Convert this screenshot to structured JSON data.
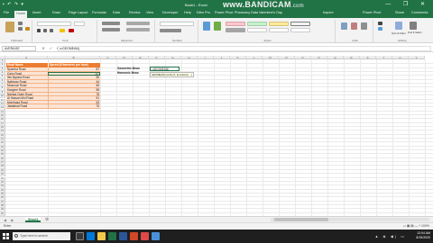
{
  "titlebar": {
    "quick_access": "▪ ↶ ↷ ▾",
    "document": "Book1 - Excel",
    "watermark": "www.BANDICAM",
    "watermark_suffix": ".com",
    "window_controls": "—  ❐  ✕"
  },
  "tabs": {
    "items": [
      "File",
      "Home",
      "Insert",
      "Draw",
      "Page Layout",
      "Formulas",
      "Data",
      "Review",
      "View",
      "Developer",
      "Help",
      "Nitro Pro",
      "Power Pivot",
      "Pharmacy Data",
      "Valentine's Day",
      "Inquire",
      "Power Pivot"
    ],
    "share": "Share",
    "comments": "Comments"
  },
  "ribbon": {
    "clipboard": "Clipboard",
    "font": "Font",
    "alignment": "Alignment",
    "number": "Number",
    "styles": "Styles",
    "cells": "Cells",
    "editing": "Editing",
    "conditional_formatting": "Conditional Formatting",
    "format_as_table": "Format as Table",
    "cell_styles": "Cell Styles",
    "sort_filter": "Sort & Filter",
    "find_select": "Find & Select"
  },
  "formula_bar": {
    "name_box": "AVERAGE",
    "fx": "✕ ✓ fx",
    "formula": "=GEOMEAN("
  },
  "columns": [
    "A",
    "B",
    "C",
    "D",
    "E",
    "F",
    "G",
    "H",
    "I",
    "J",
    "K",
    "L",
    "M",
    "N",
    "O",
    "P",
    "Q",
    "R",
    "S",
    "T",
    "U",
    "V"
  ],
  "rows": [
    "1",
    "2",
    "3",
    "4",
    "5",
    "6",
    "7",
    "8",
    "9",
    "10",
    "11",
    "12",
    "13",
    "14",
    "15",
    "16",
    "17",
    "18",
    "19",
    "20",
    "21",
    "22",
    "23",
    "24",
    "25",
    "26",
    "27",
    "28",
    "29",
    "30",
    "31",
    "32",
    "33",
    "34",
    "35",
    "36",
    "37",
    "38",
    "39",
    "40"
  ],
  "table": {
    "header_a": "Road Name",
    "header_b": "Speed (Kilometres per hour)",
    "names": [
      "Nyamira Road",
      "Cairo Road",
      "Ibis Bypass Road",
      "Nakhugo Road",
      "Mnamuzi Road",
      "Kangere Road",
      "Ndetea Outer Road",
      "Al Hassan Moi Road",
      "Mombasa Road",
      "Jalalabad Road"
    ],
    "speeds": [
      "87",
      "45",
      "56",
      "44",
      "66",
      "58",
      "78",
      "51",
      "63",
      "75"
    ]
  },
  "means": {
    "geo_label": "Geometric Mean",
    "geo_value": "=GEOMEAN(",
    "harm_label": "Harmonic Mean",
    "tooltip": "GEOMEAN(number1, [number2], ...)"
  },
  "sheetbar": {
    "nav": "◀ ▶",
    "sheet": "Sheet1",
    "add": "⊕"
  },
  "status": {
    "mode": "Enter",
    "zoom": "▭ ▦ ▤ — + 100%"
  },
  "taskbar": {
    "search": "Type here to search",
    "time": "12:04 AM",
    "date": "8/15/2020",
    "tray": "▲ ◈ ◀) ▭"
  },
  "colors": {
    "excel_green": "#217346",
    "header_orange": "#ed7d31",
    "row_fill": "#fbe4d5"
  }
}
